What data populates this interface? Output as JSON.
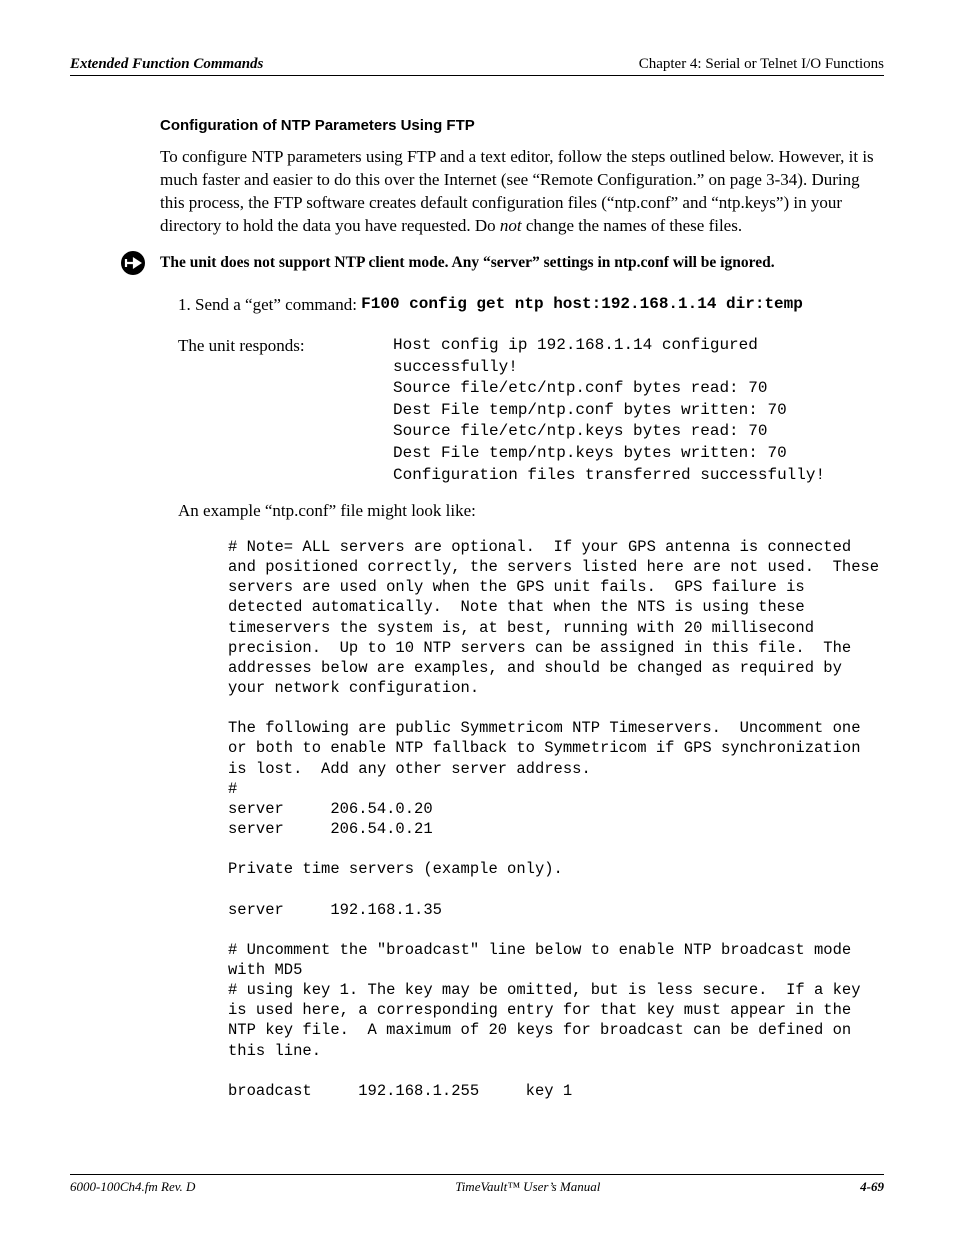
{
  "header": {
    "left": "Extended Function Commands",
    "right": "Chapter 4: Serial or Telnet I/O Functions"
  },
  "section_title": "Configuration of NTP Parameters Using FTP",
  "intro": {
    "p1a": "To configure NTP parameters using FTP and a text editor, follow the steps outlined below. However, it is much faster and easier to do this over the Internet (see “Remote Configuration.” on page 3-34). During this process, the FTP software creates default configuration files (“ntp.conf” and “ntp.keys”) in your directory to hold the data you have requested.  Do ",
    "p1_not": "not",
    "p1b": " change the names of these files."
  },
  "note": "The unit does not support NTP client mode.  Any “server” settings in ntp.conf will be ignored.",
  "step1": {
    "label": "1. Send a “get” command: ",
    "cmd": "F100 config get ntp host:192.168.1.14 dir:temp"
  },
  "response": {
    "label": "The unit responds:",
    "body": "Host config ip 192.168.1.14 configured\nsuccessfully!\nSource file/etc/ntp.conf bytes read: 70\nDest File temp/ntp.conf bytes written: 70\nSource file/etc/ntp.keys bytes read: 70\nDest File temp/ntp.keys bytes written: 70\nConfiguration files transferred successfully!"
  },
  "example_label": "An example “ntp.conf” file might look like:",
  "conf_file": "# Note= ALL servers are optional.  If your GPS antenna is connected and positioned correctly, the servers listed here are not used.  These servers are used only when the GPS unit fails.  GPS failure is detected automatically.  Note that when the NTS is using these timeservers the system is, at best, running with 20 millisecond precision.  Up to 10 NTP servers can be assigned in this file.  The addresses below are examples, and should be changed as required by your network configuration.\n\nThe following are public Symmetricom NTP Timeservers.  Uncomment one or both to enable NTP fallback to Symmetricom if GPS synchronization is lost.  Add any other server address.\n#\nserver     206.54.0.20\nserver     206.54.0.21\n\nPrivate time servers (example only).\n\nserver     192.168.1.35\n\n# Uncomment the \"broadcast\" line below to enable NTP broadcast mode with MD5\n# using key 1. The key may be omitted, but is less secure.  If a key is used here, a corresponding entry for that key must appear in the NTP key file.  A maximum of 20 keys for broadcast can be defined on this line.\n\nbroadcast     192.168.1.255     key 1",
  "footer": {
    "left": "6000-100Ch4.fm  Rev. D",
    "center": "TimeVault™ User’s Manual",
    "right": "4-69"
  }
}
